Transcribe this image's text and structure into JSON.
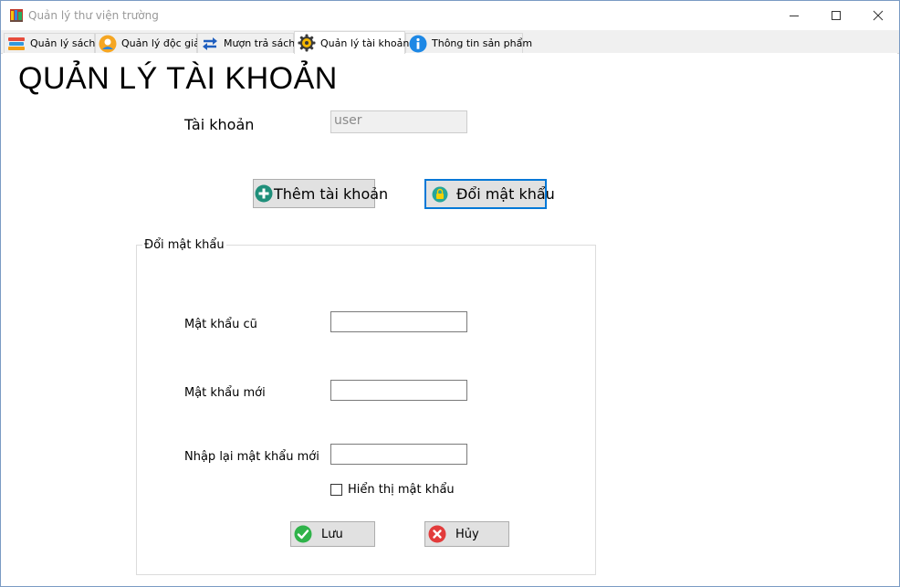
{
  "window": {
    "title": "Quản lý thư viện trường"
  },
  "tabs": [
    {
      "label": "Quản lý sách",
      "icon": "books-icon"
    },
    {
      "label": "Quản lý độc giả",
      "icon": "user-icon"
    },
    {
      "label": "Mượn trả sách",
      "icon": "swap-arrows-icon"
    },
    {
      "label": "Quản lý tài khoản",
      "icon": "gear-icon",
      "active": true
    },
    {
      "label": "Thông tin sản phẩm",
      "icon": "info-icon"
    }
  ],
  "page": {
    "title": "QUẢN LÝ TÀI KHOẢN",
    "account_label": "Tài khoản",
    "account_value": "user",
    "add_account_button": "Thêm tài khoản",
    "change_password_button": "Đổi mật khẩu"
  },
  "password_group": {
    "legend": "Đổi mật khẩu",
    "old_password_label": "Mật khẩu cũ",
    "old_password_value": "",
    "new_password_label": "Mật khẩu mới",
    "new_password_value": "",
    "confirm_password_label": "Nhập lại mật khẩu mới",
    "confirm_password_value": "",
    "show_password_label": "Hiển thị mật khẩu",
    "show_password_checked": false,
    "save_button": "Lưu",
    "cancel_button": "Hủy"
  },
  "colors": {
    "accent": "#0078d7",
    "button_face": "#e1e1e1",
    "success": "#2fb34a",
    "danger": "#e23b3b"
  }
}
